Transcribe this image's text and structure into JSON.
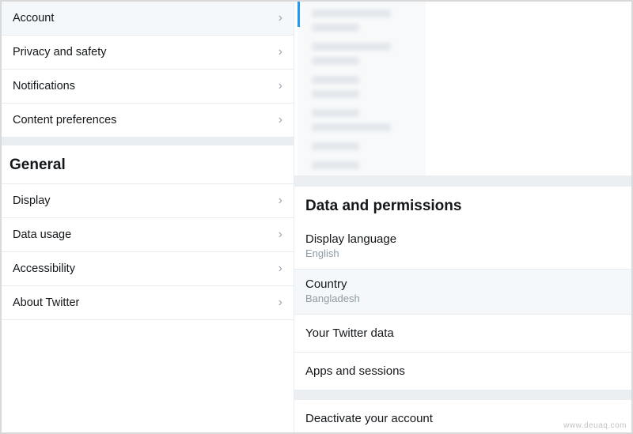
{
  "sidebar": {
    "top_items": [
      {
        "label": "Account",
        "selected": true
      },
      {
        "label": "Privacy and safety",
        "selected": false
      },
      {
        "label": "Notifications",
        "selected": false
      },
      {
        "label": "Content preferences",
        "selected": false
      }
    ],
    "general_header": "General",
    "general_items": [
      {
        "label": "Display"
      },
      {
        "label": "Data usage"
      },
      {
        "label": "Accessibility"
      },
      {
        "label": "About Twitter"
      }
    ]
  },
  "right": {
    "section_title": "Data and permissions",
    "rows": [
      {
        "label": "Display language",
        "sub": "English",
        "highlight": false
      },
      {
        "label": "Country",
        "sub": "Bangladesh",
        "highlight": true
      },
      {
        "label": "Your Twitter data",
        "sub": null,
        "highlight": false
      },
      {
        "label": "Apps and sessions",
        "sub": null,
        "highlight": false
      },
      {
        "label": "Deactivate your account",
        "sub": null,
        "highlight": false,
        "separator_before": true
      }
    ]
  },
  "glyphs": {
    "chevron_right": "›"
  },
  "colors": {
    "accent": "#1d9bf0",
    "arrow": "#ff0000"
  },
  "watermark": "www.deuaq.com"
}
